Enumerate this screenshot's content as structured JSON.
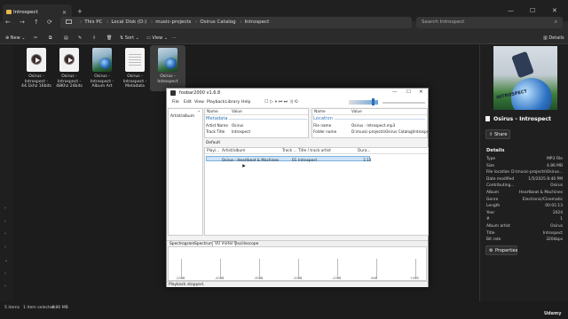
{
  "window": {
    "tab_title": "Introspect"
  },
  "address": {
    "crumbs": [
      "This PC",
      "Local Disk (D:)",
      "music-projects",
      "Osirus Catalog",
      "Introspect"
    ],
    "search_placeholder": "Search Introspect"
  },
  "toolbar": {
    "new": "New",
    "sort": "Sort",
    "view": "View",
    "details": "Details"
  },
  "files": [
    {
      "name": "Osirus - Introspect - 44.1khz 16bits",
      "type": "audio"
    },
    {
      "name": "Osirus - Introspect - 48Khz 24bits",
      "type": "audio"
    },
    {
      "name": "Osirus - Introspect - Album Art",
      "type": "image"
    },
    {
      "name": "Osirus - Introspect - Metadata",
      "type": "text"
    },
    {
      "name": "Osirus - Introspect",
      "type": "image",
      "selected": true
    }
  ],
  "details": {
    "title": "Osirus - Introspect",
    "share": "Share",
    "heading": "Details",
    "props": [
      [
        "Type",
        "MP3 File"
      ],
      [
        "Size",
        "4.86 MB"
      ],
      [
        "File location",
        "D:\\music-projects\\Osirus..."
      ],
      [
        "Date modified",
        "1/5/2025 8:40 PM"
      ],
      [
        "Contributing...",
        "Osirus"
      ],
      [
        "Album",
        "Heartbeat & Machines"
      ],
      [
        "Genre",
        "Electronic/Cinematic"
      ],
      [
        "Length",
        "00:01:13"
      ],
      [
        "Year",
        "2024"
      ],
      [
        "#",
        "1"
      ],
      [
        "Album artist",
        "Osirus"
      ],
      [
        "Title",
        "Introspect"
      ],
      [
        "Bit rate",
        "320kbps"
      ]
    ],
    "properties_btn": "Properties"
  },
  "status": {
    "items": "5 items",
    "selected": "1 item selected",
    "size": "4.86 MB"
  },
  "foobar": {
    "title": "foobar2000 v1.6.8",
    "menu": [
      "File",
      "Edit",
      "View",
      "Playback",
      "Library",
      "Help"
    ],
    "library_item": "Artist/album",
    "meta_cols": [
      "Name",
      "Value"
    ],
    "meta_group": "Metadata",
    "meta_rows": [
      [
        "Artist Name",
        "Osirus"
      ],
      [
        "Track Title",
        "Introspect"
      ]
    ],
    "loc_cols": [
      "Name",
      "Value"
    ],
    "loc_group": "Location",
    "loc_rows": [
      [
        "File name",
        "Osirus - Introspect.mp3"
      ],
      [
        "Folder name",
        "D:\\music-projects\\Osirus Catalog\\Introspe"
      ]
    ],
    "playlist_tab": "Default",
    "pl_cols": [
      "Playi...",
      "Artist/album",
      "Track ...",
      "Title / track artist",
      "Dura..."
    ],
    "pl_row": {
      "artist_album": "Osirus - Heartbeat & Machines",
      "track": "01",
      "title": "Introspect",
      "duration": "1:13"
    },
    "vis_tabs": [
      "Spectrogram",
      "Spectrum",
      "VU meter",
      "Oscilloscope"
    ],
    "vis_active": "VU meter",
    "vis_labels": [
      "-20dB",
      "-40dB",
      "-30dB",
      "-20dB",
      "-10dB",
      "0dB",
      "+5dB"
    ],
    "status": "Playback stopped."
  },
  "watermark": "Udemy"
}
